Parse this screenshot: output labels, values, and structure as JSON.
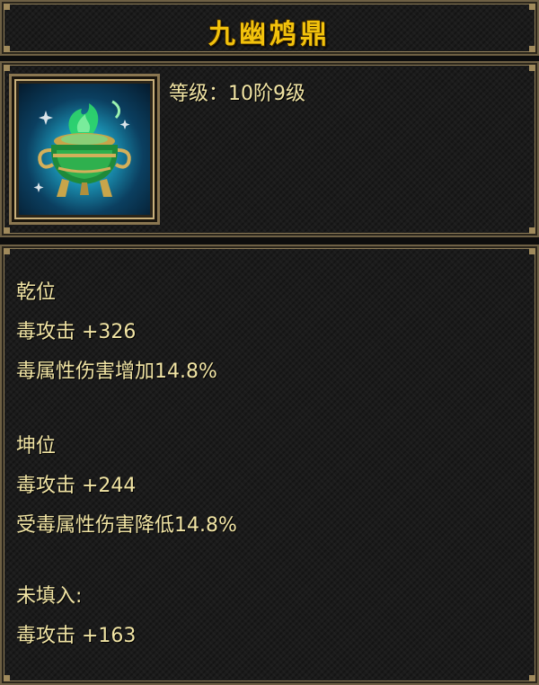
{
  "item": {
    "name": "九幽鸩鼎",
    "level_text": "等级：10阶9级",
    "icon": "green-poison-cauldron-icon"
  },
  "sections": [
    {
      "title": "乾位",
      "lines": [
        "毒攻击 +326",
        "毒属性伤害增加14.8%"
      ]
    },
    {
      "title": "坤位",
      "lines": [
        "毒攻击 +244",
        "受毒属性伤害降低14.8%"
      ]
    },
    {
      "title": "未填入:",
      "lines": [
        "毒攻击 +163"
      ]
    }
  ],
  "colors": {
    "title": "#f2c20c",
    "text": "#f1e4a4",
    "frame": "#8a7650"
  }
}
